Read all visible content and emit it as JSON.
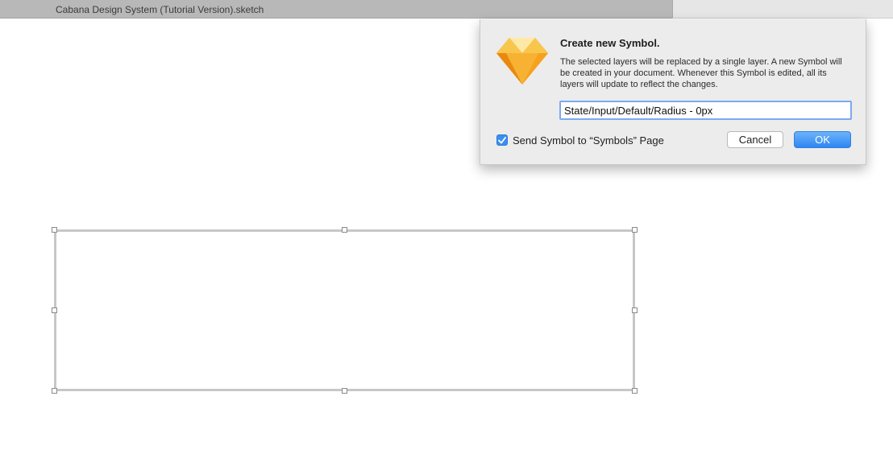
{
  "window": {
    "title": "Cabana Design System (Tutorial Version).sketch"
  },
  "dialog": {
    "icon": "sketch-diamond-icon",
    "title": "Create new Symbol.",
    "message": "The selected layers will be replaced by a single layer. A new Symbol will be created in your document. Whenever this Symbol is edited, all its layers will update to reflect the changes.",
    "symbol_name": "State/Input/Default/Radius - 0px",
    "send_to_symbols_page": {
      "label": "Send Symbol to “Symbols” Page",
      "checked": true
    },
    "cancel_label": "Cancel",
    "ok_label": "OK"
  },
  "canvas": {
    "selected_layer": "rectangle"
  },
  "colors": {
    "accent": "#3b8ef2",
    "gem_orange": "#f5a623",
    "titlebar": "#b9b8b9"
  }
}
